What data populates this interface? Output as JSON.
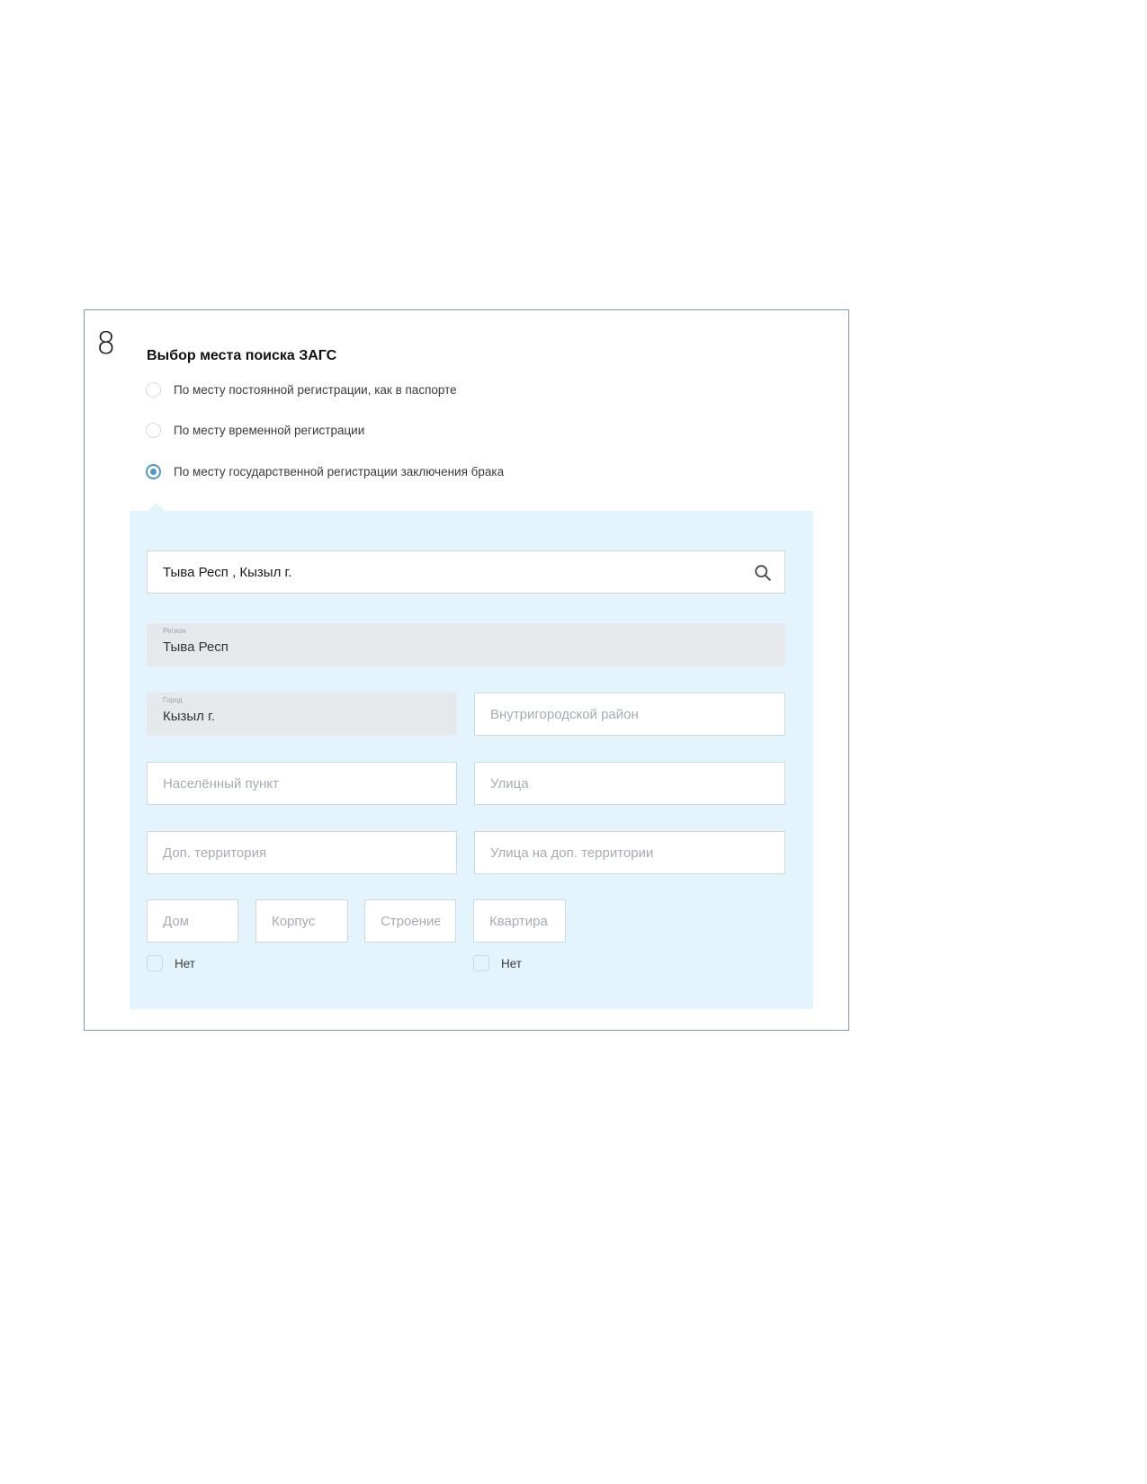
{
  "step": {
    "number": "8",
    "title": "Выбор места поиска ЗАГС"
  },
  "options": [
    {
      "label": "По месту постоянной регистрации, как в паспорте",
      "checked": false
    },
    {
      "label": "По месту временной регистрации",
      "checked": false
    },
    {
      "label": "По месту государственной регистрации заключения брака",
      "checked": true
    }
  ],
  "address": {
    "search_value": "Тыва Респ , Кызыл г.",
    "region_label": "Регион",
    "region_value": "Тыва Респ",
    "city_label": "Город",
    "city_value": "Кызыл г.",
    "district_placeholder": "Внутригородской район",
    "settlement_placeholder": "Населённый пункт",
    "street_placeholder": "Улица",
    "extra_territory_placeholder": "Доп. территория",
    "extra_street_placeholder": "Улица на доп. территории",
    "house_placeholder": "Дом",
    "building_placeholder": "Корпус",
    "structure_placeholder": "Строение",
    "apartment_placeholder": "Квартира",
    "no_house_label": "Нет",
    "no_apartment_label": "Нет"
  },
  "colors": {
    "accent": "#4f97c6",
    "panel_background": "#e4f4fc",
    "readonly_background": "#e6e9ec",
    "frame_border": "#7f97ad"
  },
  "icons": {
    "search": "search-icon"
  }
}
